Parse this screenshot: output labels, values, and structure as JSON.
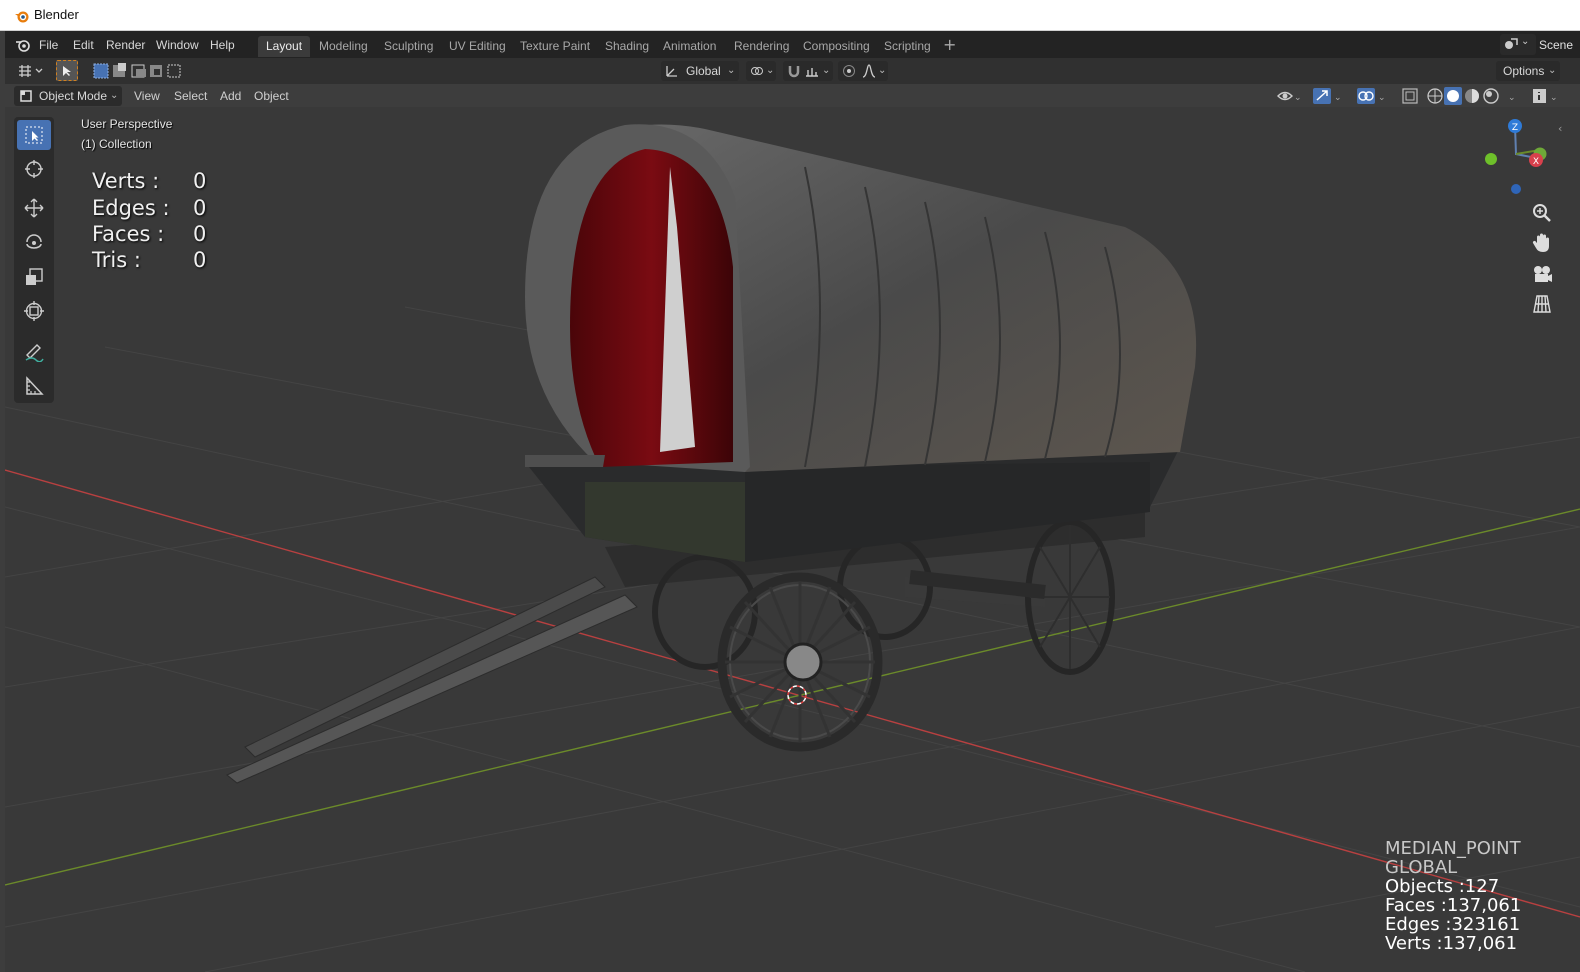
{
  "window": {
    "title": "Blender"
  },
  "menubar": {
    "file": "File",
    "edit": "Edit",
    "render": "Render",
    "window": "Window",
    "help": "Help"
  },
  "workspaces": [
    "Layout",
    "Modeling",
    "Sculpting",
    "UV Editing",
    "Texture Paint",
    "Shading",
    "Animation",
    "Rendering",
    "Compositing",
    "Scripting"
  ],
  "scene_label": "Scene",
  "toolheader": {
    "orientation": "Global",
    "options": "Options"
  },
  "viewheader": {
    "mode": "Object Mode",
    "view": "View",
    "select": "Select",
    "add": "Add",
    "object": "Object"
  },
  "viewport": {
    "perspective": "User Perspective",
    "collection": "(1) Collection",
    "stats": [
      {
        "label": "Verts :",
        "value": "0"
      },
      {
        "label": "Edges :",
        "value": "0"
      },
      {
        "label": "Faces :",
        "value": "0"
      },
      {
        "label": "Tris :",
        "value": "0"
      }
    ],
    "info": {
      "pivot": "MEDIAN_POINT",
      "orientation": "GLOBAL",
      "objects": "Objects :127",
      "faces": "Faces :137,061",
      "edges": "Edges :323161",
      "verts": "Verts :137,061"
    },
    "gizmo": {
      "z": "Z",
      "x": "X"
    }
  },
  "colors": {
    "accent": "#4772b3",
    "x_axis": "#b84040",
    "y_axis": "#6b8a2a",
    "curtain": "#6d0a10"
  }
}
